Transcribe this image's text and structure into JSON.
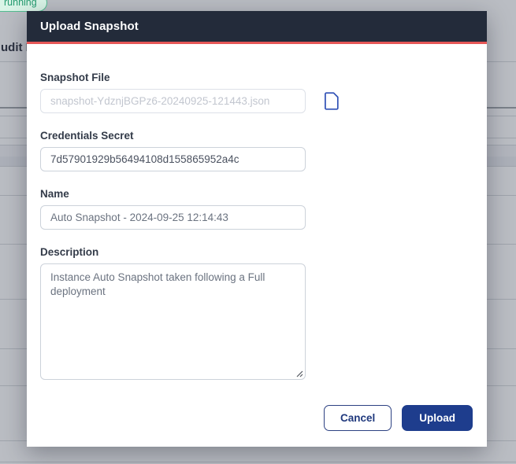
{
  "background": {
    "heading_partial": "udit L",
    "status_badge": "running"
  },
  "modal": {
    "title": "Upload Snapshot",
    "fields": {
      "snapshot_file": {
        "label": "Snapshot File",
        "placeholder": "snapshot-YdznjBGPz6-20240925-121443.json"
      },
      "credentials_secret": {
        "label": "Credentials Secret",
        "value": "7d57901929b56494108d155865952a4c"
      },
      "name": {
        "label": "Name",
        "value": "Auto Snapshot - 2024-09-25 12:14:43"
      },
      "description": {
        "label": "Description",
        "value": "Instance Auto Snapshot taken following a Full deployment"
      }
    },
    "buttons": {
      "cancel": "Cancel",
      "upload": "Upload"
    }
  },
  "colors": {
    "header_bg": "#232b3a",
    "header_accent_line": "#e65757",
    "primary_button": "#1e3d8d",
    "badge_green_bg": "#d9f4e7",
    "badge_green_text": "#259b70",
    "file_icon_blue": "#2e4fb5",
    "overlay_gray": "#babdc3"
  }
}
